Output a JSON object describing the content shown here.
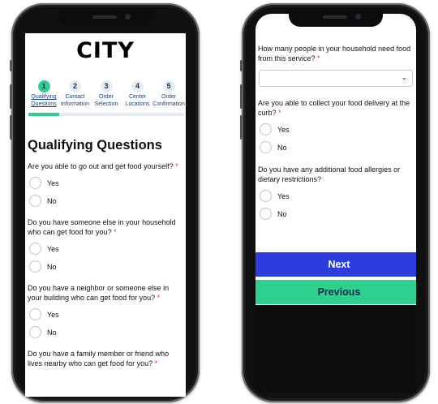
{
  "left_screen": {
    "logo": "CITY",
    "steps": [
      {
        "num": "1",
        "line1": "Qualifying",
        "line2": "Questions"
      },
      {
        "num": "2",
        "line1": "Contact",
        "line2": "Information"
      },
      {
        "num": "3",
        "line1": "Order",
        "line2": "Selection"
      },
      {
        "num": "4",
        "line1": "Center",
        "line2": "Locations"
      },
      {
        "num": "5",
        "line1": "Order",
        "line2": "Confirmation"
      }
    ],
    "progress_fraction": 0.2,
    "section_title": "Qualifying Questions",
    "questions": [
      {
        "text": "Are you able to go out and get food yourself?",
        "options": [
          "Yes",
          "No"
        ]
      },
      {
        "text": "Do you have someone else in your household who can get food for you?",
        "options": [
          "Yes",
          "No"
        ]
      },
      {
        "text": "Do you have a neighbor or someone else in your building who can get food for you?",
        "options": [
          "Yes",
          "No"
        ]
      },
      {
        "text": "Do you have a family member or friend who lives nearby who can get food for you?",
        "options": []
      }
    ]
  },
  "right_screen": {
    "household_question": "How many people in your household need food from this service?",
    "curb_question": "Are you able to collect your food delivery at the curb?",
    "curb_options": [
      "Yes",
      "No"
    ],
    "allergy_question": "Do you have any additional food allergies or dietary restrictions?",
    "allergy_options": [
      "Yes",
      "No"
    ],
    "next_label": "Next",
    "previous_label": "Previous"
  },
  "required_mark": "*",
  "colors": {
    "accent_green": "#2fd08d",
    "next_blue": "#2b3ce0",
    "required_red": "#e03030"
  },
  "icons": {
    "select_arrow": "chevron-down-icon"
  }
}
